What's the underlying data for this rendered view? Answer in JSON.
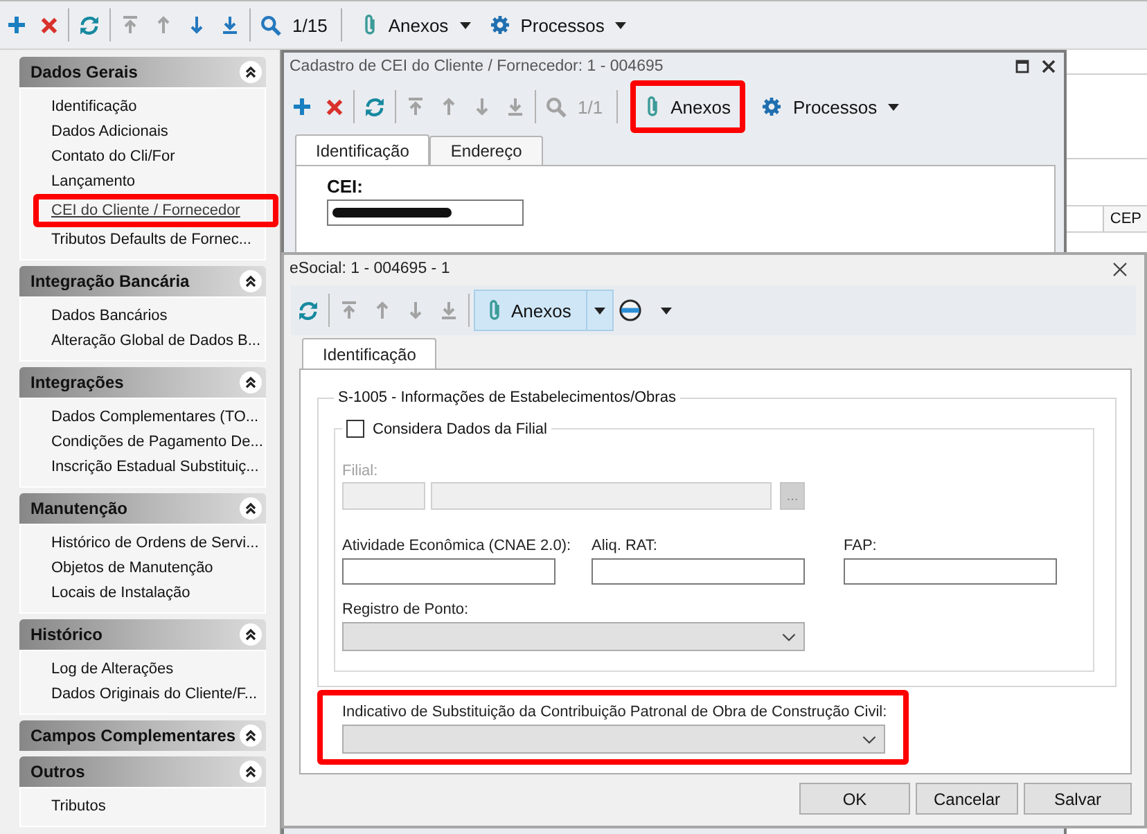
{
  "main_toolbar": {
    "nav_buttons": [
      {
        "disabled": true
      },
      {
        "disabled": true
      },
      {
        "disabled": false
      },
      {
        "disabled": false
      }
    ],
    "search": {
      "disabled": false,
      "counter": "1/15"
    },
    "menus": [
      {
        "label": "Anexos",
        "dropdown": true
      },
      {
        "label": "Processos",
        "dropdown": true
      }
    ]
  },
  "sidebar": {
    "groups": [
      {
        "title": "Dados Gerais",
        "expanded": true,
        "items": [
          {
            "label": "Identificação",
            "selected": false,
            "highlighted": false
          },
          {
            "label": "Dados Adicionais",
            "selected": false,
            "highlighted": false
          },
          {
            "label": "Contato do Cli/For",
            "selected": false,
            "highlighted": false
          },
          {
            "label": "Lançamento",
            "selected": false,
            "highlighted": false
          },
          {
            "label": "CEI do Cliente / Fornecedor",
            "selected": true,
            "highlighted": true
          },
          {
            "label": "Tributos Defaults de Fornec...",
            "selected": false,
            "highlighted": false
          }
        ]
      },
      {
        "title": "Integração Bancária",
        "expanded": true,
        "items": [
          {
            "label": "Dados Bancários",
            "selected": false,
            "highlighted": false
          },
          {
            "label": "Alteração Global de Dados B...",
            "selected": false,
            "highlighted": false
          }
        ]
      },
      {
        "title": "Integrações",
        "expanded": true,
        "items": [
          {
            "label": "Dados Complementares (TO...",
            "selected": false,
            "highlighted": false
          },
          {
            "label": "Condições de Pagamento De...",
            "selected": false,
            "highlighted": false
          },
          {
            "label": "Inscrição Estadual Substituiç...",
            "selected": false,
            "highlighted": false
          }
        ]
      },
      {
        "title": "Manutenção",
        "expanded": true,
        "items": [
          {
            "label": "Histórico de Ordens de Servi...",
            "selected": false,
            "highlighted": false
          },
          {
            "label": "Objetos de Manutenção",
            "selected": false,
            "highlighted": false
          },
          {
            "label": "Locais de Instalação",
            "selected": false,
            "highlighted": false
          }
        ]
      },
      {
        "title": "Histórico",
        "expanded": true,
        "items": [
          {
            "label": "Log de Alterações",
            "selected": false,
            "highlighted": false
          },
          {
            "label": "Dados Originais do Cliente/F...",
            "selected": false,
            "highlighted": false
          }
        ]
      },
      {
        "title": "Campos Complementares",
        "expanded": true
      },
      {
        "title": "Outros",
        "expanded": true,
        "items": [
          {
            "label": "Tributos",
            "selected": false,
            "highlighted": false
          }
        ]
      }
    ]
  },
  "background_grid": {
    "columns": [
      {
        "label": "CEP"
      }
    ]
  },
  "record_window": {
    "title": "Cadastro de CEI do Cliente / Fornecedor: 1 - 004695",
    "toolbar": {
      "nav_buttons": [
        {
          "disabled": true
        },
        {
          "disabled": true
        },
        {
          "disabled": true
        },
        {
          "disabled": true
        }
      ],
      "search": {
        "disabled": true,
        "counter": "1/1"
      },
      "menus": [
        {
          "label": "Anexos",
          "dropdown": false,
          "highlighted": true
        },
        {
          "label": "Processos",
          "dropdown": true,
          "highlighted": false
        }
      ]
    },
    "tabs": [
      {
        "label": "Identificação",
        "selected": true
      },
      {
        "label": "Endereço",
        "selected": false
      }
    ],
    "field": {
      "label": "CEI:",
      "redacted": true
    }
  },
  "esocial_dialog": {
    "title": "eSocial: 1 - 004695 - 1",
    "toolbar": {
      "nav_buttons": [
        {
          "disabled": true
        },
        {
          "disabled": true
        },
        {
          "disabled": true
        },
        {
          "disabled": true
        }
      ],
      "menus": [
        {
          "label": "Anexos",
          "dropdown": true,
          "hovered": true
        }
      ]
    },
    "tabs": [
      {
        "label": "Identificação",
        "selected": true
      }
    ],
    "group": {
      "legend": "S-1005 - Informações de Estabelecimentos/Obras",
      "subgroup": {
        "checkbox": {
          "label": "Considera Dados da Filial",
          "checked": false
        },
        "filial": {
          "label": "Filial:",
          "button": "...",
          "disabled": true
        },
        "fields": [
          {
            "kind": "text",
            "label": "Atividade Econômica (CNAE 2.0):"
          },
          {
            "kind": "text",
            "label": "Aliq. RAT:"
          },
          {
            "kind": "text",
            "label": "FAP:"
          },
          {
            "kind": "select",
            "label": "Registro de Ponto:"
          }
        ]
      }
    },
    "indicativo": {
      "kind": "select",
      "label": "Indicativo de Substituição da Contribuição Patronal de Obra de Construção Civil:",
      "highlighted": true
    },
    "buttons": [
      {
        "label": "OK"
      },
      {
        "label": "Cancelar"
      },
      {
        "label": "Salvar"
      }
    ]
  }
}
